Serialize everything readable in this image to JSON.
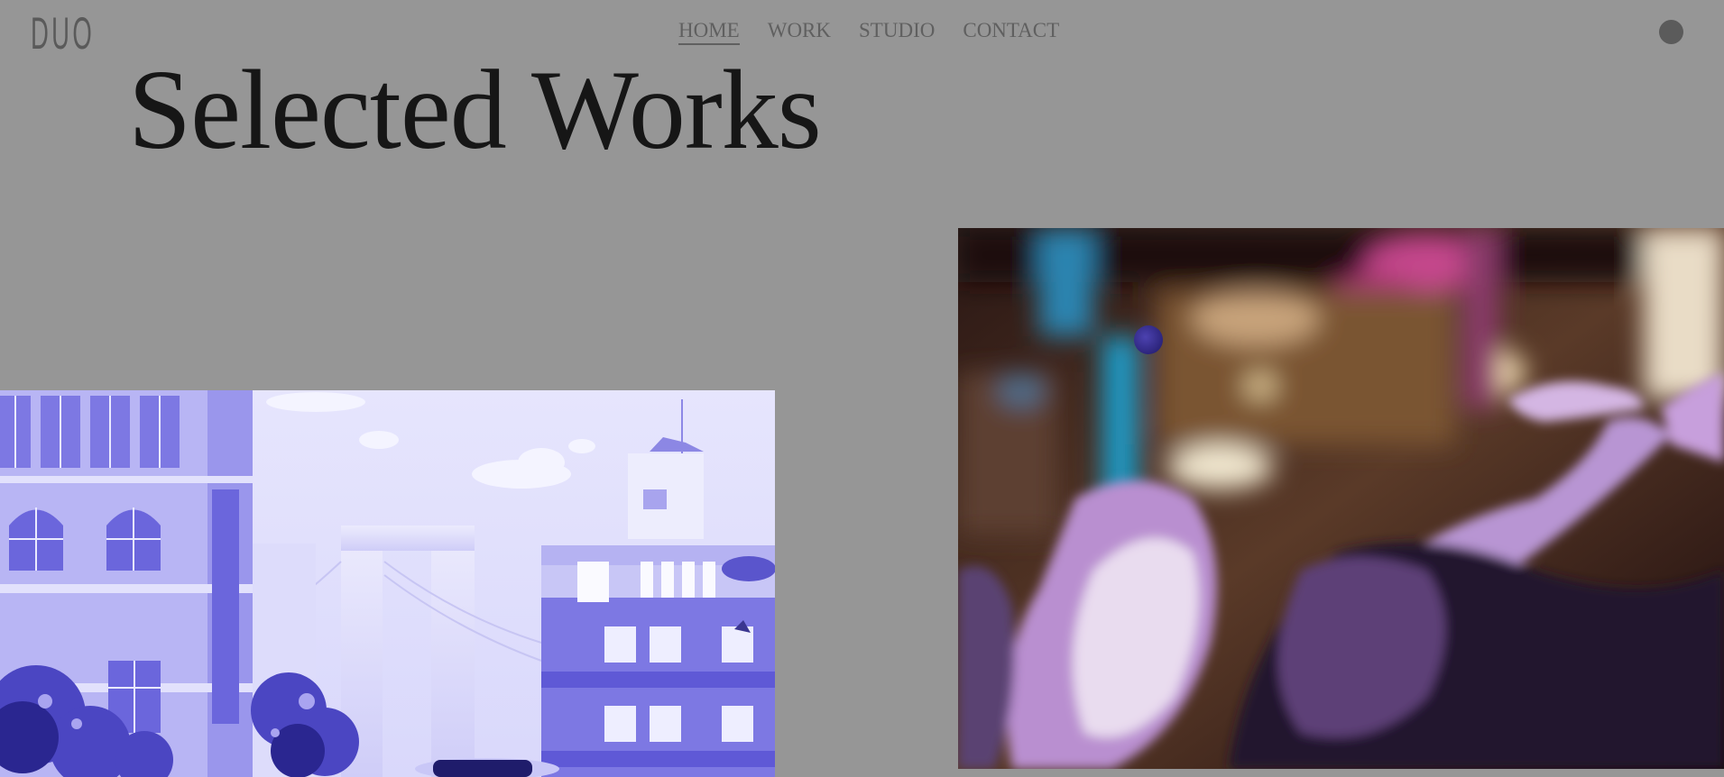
{
  "brand": {
    "logo_text": "DUO"
  },
  "nav": {
    "items": [
      "HOME",
      "WORK",
      "STUDIO",
      "CONTACT"
    ],
    "active": "HOME"
  },
  "hero": {
    "title": "Selected Works"
  },
  "colors": {
    "background": "#969696",
    "title": "#161616",
    "nav_text": "#606060",
    "accent_purple": "#6f6bd8",
    "cursor": "#3a329a"
  },
  "icons": {
    "menu": "menu-dot-icon",
    "cursor": "cursor-dot-icon"
  },
  "works": [
    {
      "name": "city-illustration",
      "kind": "illustration"
    },
    {
      "name": "concert-video",
      "kind": "video"
    }
  ]
}
